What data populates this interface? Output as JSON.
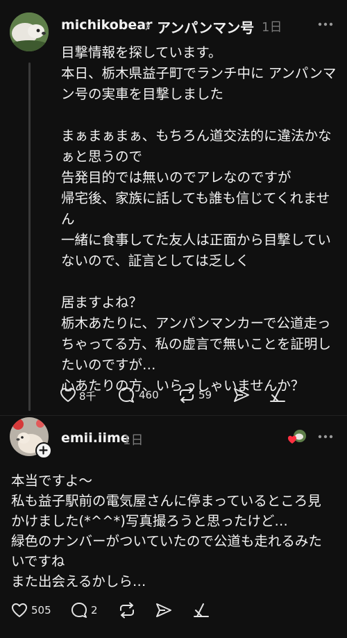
{
  "post": {
    "username": "michikobear",
    "separator": "›",
    "community": "アンパンマン号",
    "time": "1日",
    "body": "目撃情報を探しています。\n本日、栃木県益子町でランチ中に アンパンマン号の実車を目撃しました\n\nまぁまぁまぁ、もちろん道交法的に違法かなぁと思うので\n告発目的では無いのでアレなのですが\n帰宅後、家族に話しても誰も信じてくれません\n一緒に食事してた友人は正面から目撃していないので、証言としては乏しく\n\n居ますよね？\n栃木あたりに、アンパンマンカーで公道走っちゃってる方、私の虚言で無いことを証明したいのですが…\n心あたりの方、いらっしゃいませんか？",
    "likes": "8千",
    "replies": "460",
    "reposts": "59"
  },
  "reply": {
    "username": "emii.iime",
    "time": "1日",
    "body": "本当ですよ〜\n私も益子駅前の電気屋さんに停まっているところ見かけました(*^^*)写真撮ろうと思ったけど…\n緑色のナンバーがついていたので公道も走れるみたいですね\nまた出会えるかしら…",
    "likes": "505",
    "replies": "2"
  },
  "colors": {
    "background": "#101010",
    "text": "#f3f3f3",
    "muted": "#7a7a7a",
    "heart_badge": "#ff3040"
  },
  "icons": {
    "more": "more-horizontal-icon",
    "like": "heart-icon",
    "reply": "comment-icon",
    "repost": "repost-icon",
    "share": "send-icon",
    "quote": "quote-icon",
    "follow": "plus-icon"
  }
}
